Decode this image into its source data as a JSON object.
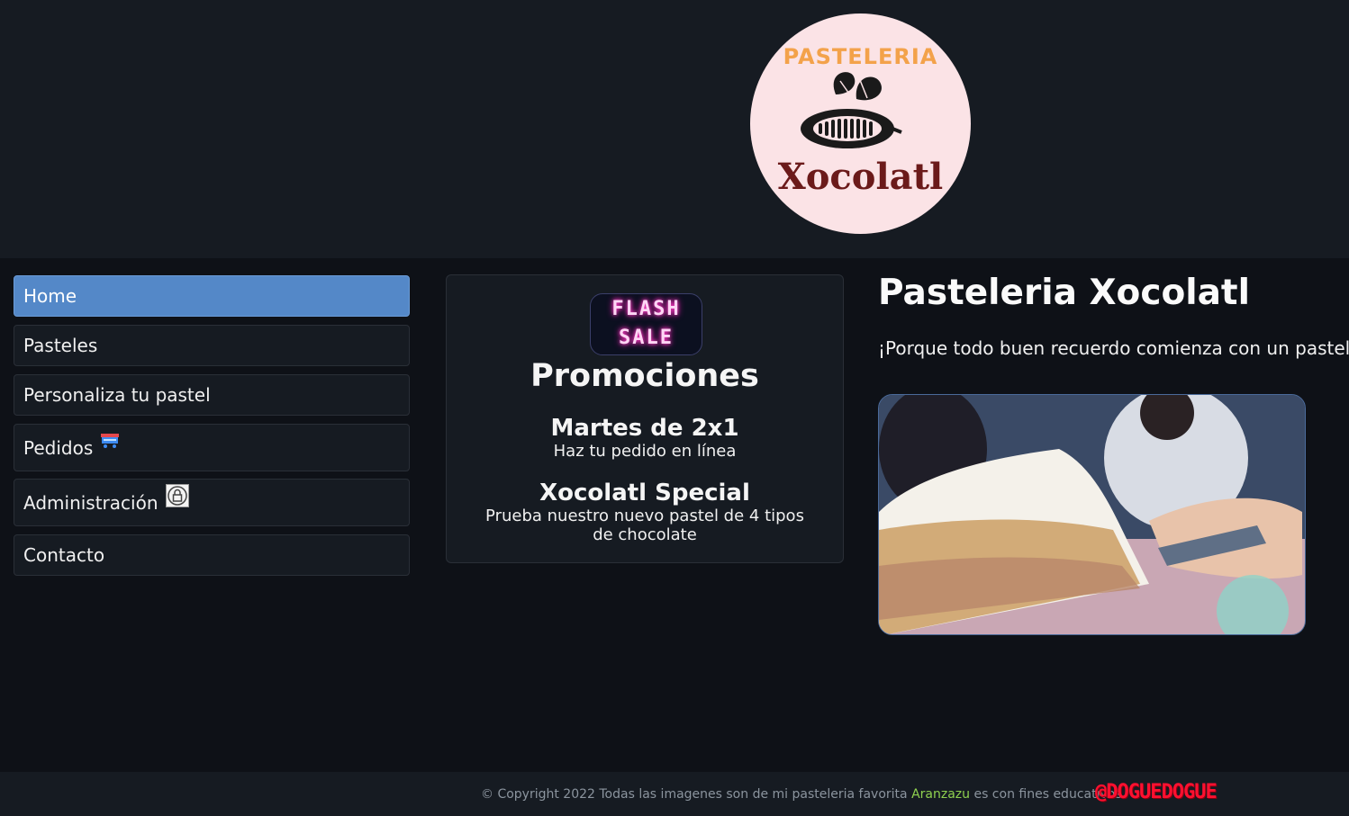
{
  "header": {
    "logo": {
      "top_text": "PASTELERIA",
      "bottom_text": "Xocolatl",
      "icon": "cacao-pod-icon"
    }
  },
  "nav": {
    "items": [
      {
        "label": "Home",
        "active": true
      },
      {
        "label": "Pasteles",
        "active": false
      },
      {
        "label": "Personaliza tu pastel",
        "active": false
      },
      {
        "label": "Pedidos",
        "active": false,
        "icon": "delivery-cart-icon"
      },
      {
        "label": "Administración",
        "active": false,
        "icon": "lock-shield-icon"
      },
      {
        "label": "Contacto",
        "active": false
      }
    ]
  },
  "promo": {
    "badge_line1": "FLASH",
    "badge_line2": "SALE",
    "title": "Promociones",
    "offers": [
      {
        "title": "Martes de 2x1",
        "desc": "Haz tu pedido en línea"
      },
      {
        "title": "Xocolatl Special",
        "desc": "Prueba nuestro nuevo pastel de 4 tipos de chocolate"
      }
    ]
  },
  "main": {
    "title": "Pasteleria Xocolatl",
    "subtitle": "¡Porque todo buen recuerdo comienza con un pastel!"
  },
  "footer": {
    "text_before": "© Copyright 2022 Todas las imagenes son de mi pasteleria favorita ",
    "link": "Aranzazu",
    "text_after": " es con fines educativos",
    "tag": "@DOGUEDOGUE"
  },
  "colors": {
    "background": "#0e1117",
    "panel": "#161b22",
    "active_nav": "#5488c8",
    "footer_link": "#8fd14f",
    "footer_tag": "#ff1030"
  }
}
